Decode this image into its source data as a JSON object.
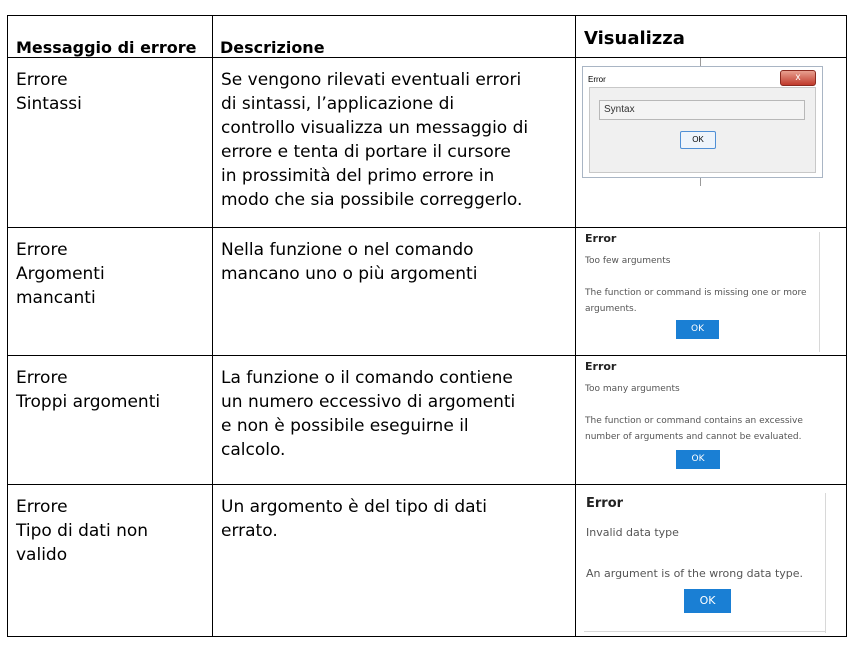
{
  "table": {
    "headers": [
      "Messaggio di errore",
      "Descrizione",
      "Visualizza"
    ],
    "rows": [
      {
        "message": [
          "Errore",
          "Sintassi"
        ],
        "description": [
          "Se vengono rilevati eventuali errori",
          "di sintassi, l’applicazione di",
          "controllo visualizza un messaggio di",
          "errore e tenta di portare il cursore",
          "in prossimità del primo errore in",
          "modo che sia possibile correggerlo."
        ],
        "preview": {
          "title": "Error",
          "close": "x",
          "field": "Syntax",
          "ok": "OK"
        }
      },
      {
        "message": [
          "Errore",
          "Argomenti",
          "mancanti"
        ],
        "description": [
          "Nella funzione o nel comando",
          "mancano uno o più argomenti"
        ],
        "preview": {
          "title": "Error",
          "message": "Too few arguments",
          "detail": [
            "The function or command is missing one or more",
            "arguments."
          ],
          "ok": "OK"
        }
      },
      {
        "message": [
          "Errore",
          "Troppi argomenti"
        ],
        "description": [
          "La funzione o il comando contiene",
          "un numero eccessivo di argomenti",
          "e non è possibile eseguirne il",
          "calcolo."
        ],
        "preview": {
          "title": "Error",
          "message": "Too many arguments",
          "detail": [
            "The function or command contains an excessive",
            "number of arguments and cannot be evaluated."
          ],
          "ok": "OK"
        }
      },
      {
        "message": [
          "Errore",
          "Tipo di dati non",
          "valido"
        ],
        "description": [
          "Un argomento è del tipo di dati",
          "errato."
        ],
        "preview": {
          "title": "Error",
          "message": "Invalid data type",
          "detail": [
            "An argument is of the wrong data type."
          ],
          "ok": "OK"
        }
      }
    ]
  }
}
